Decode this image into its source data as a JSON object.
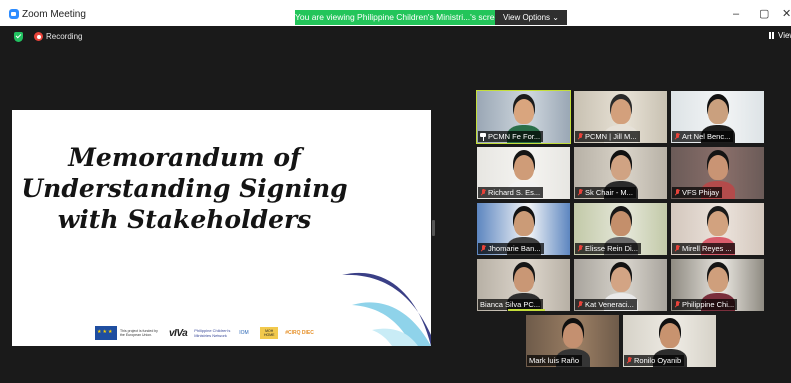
{
  "window": {
    "title": "Zoom Meeting",
    "share_banner": "You are viewing Philippine Children's Ministri...'s screen",
    "view_options_label": "View Options ⌄",
    "controls": [
      "–",
      "▢",
      "✕"
    ]
  },
  "status": {
    "recording_label": "Recording",
    "view_label": "View"
  },
  "slide": {
    "title_lines": [
      "Memorandum of",
      "Understanding Signing",
      "with Stakeholders"
    ],
    "logos": {
      "eu_text": "This project is funded by the European Union.",
      "viva": "vIVa",
      "pcmn": "Philippine Children's Ministries Network",
      "iom": "IOM",
      "moh": "MOH HOME",
      "cirq": "#CIRQ DIEC"
    }
  },
  "participants": [
    {
      "name": "PCMN Fe For...",
      "muted": false,
      "pinned": true,
      "active": true
    },
    {
      "name": "PCMN | Jill M...",
      "muted": true
    },
    {
      "name": "Art Nel Benc...",
      "muted": true
    },
    {
      "name": "Richard S. Es...",
      "muted": true
    },
    {
      "name": "Sk Chair - M...",
      "muted": true
    },
    {
      "name": "VFS Phijay",
      "muted": true
    },
    {
      "name": "Jhomarie Ban...",
      "muted": true
    },
    {
      "name": "Elisse Rein Di...",
      "muted": true
    },
    {
      "name": "Mirell Reyes ...",
      "muted": true
    },
    {
      "name": "Bianca Silva PC...",
      "muted": false
    },
    {
      "name": "Kat Veneraci...",
      "muted": true
    },
    {
      "name": "Philippine Chi...",
      "muted": true
    },
    {
      "name": "Mark luis Raño",
      "muted": false
    },
    {
      "name": "Ronilo Oyanib",
      "muted": true
    }
  ],
  "colors": {
    "active_speaker": "#c4de3b",
    "banner_green": "#23c55a",
    "recording_red": "#e8433a"
  }
}
